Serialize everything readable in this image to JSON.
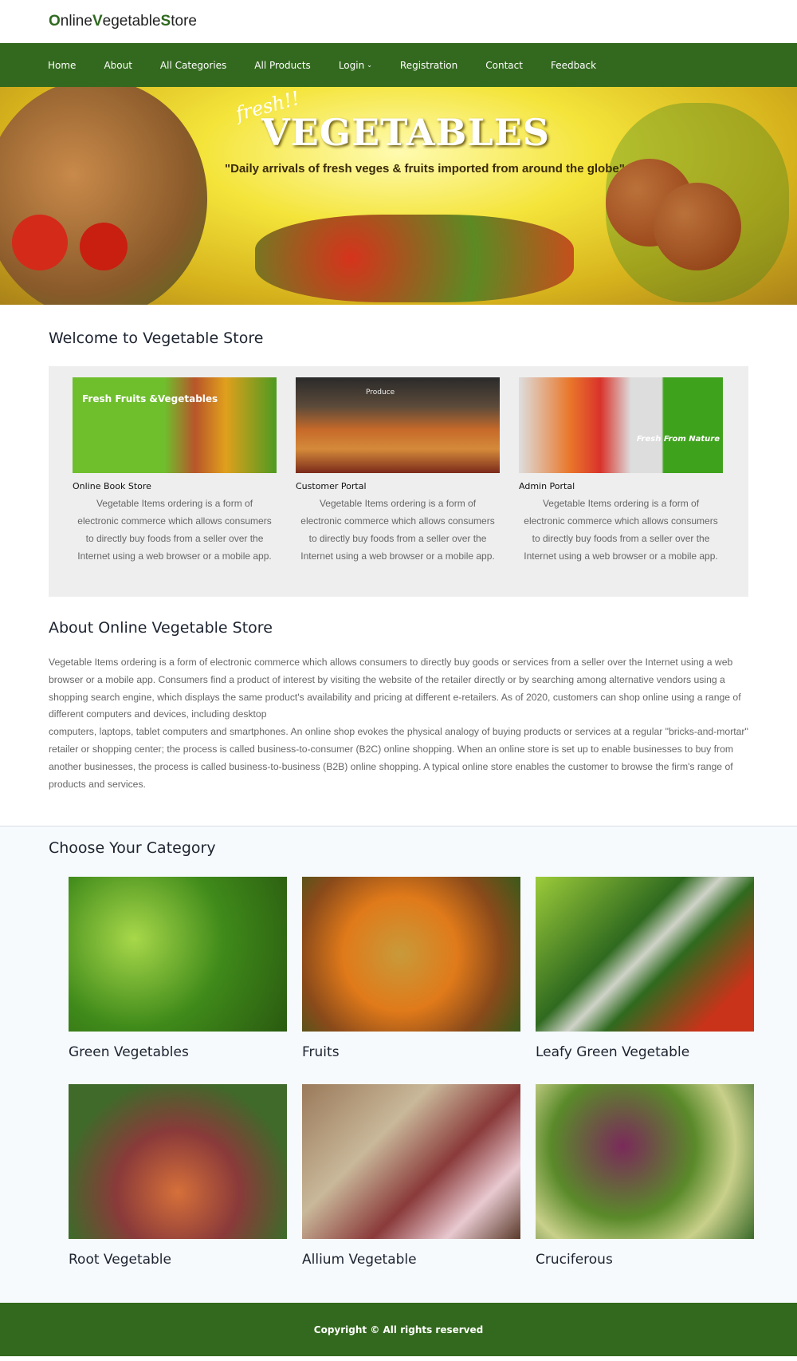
{
  "brand": {
    "first": "O",
    "w1": "nline ",
    "second": "V",
    "w2": "egetable ",
    "third": "S",
    "w3": "tore"
  },
  "nav": [
    "Home",
    "About",
    "All Categories",
    "All Products",
    "Login",
    "Registration",
    "Contact",
    "Feedback"
  ],
  "banner": {
    "script": "fresh!!",
    "title": "VEGETABLES",
    "tagline": "\"Daily arrivals of fresh veges & fruits imported from around the globe\""
  },
  "welcome": {
    "heading": "Welcome to Vegetable Store",
    "cards": [
      {
        "title": "Online Book Store",
        "image_text": "Fresh Fruits &Vegetables",
        "text": "Vegetable Items ordering is a form of electronic commerce which allows consumers to directly buy foods from a seller over the Internet using a web browser or a mobile app."
      },
      {
        "title": "Customer Portal",
        "image_text": "Produce",
        "text": "Vegetable Items ordering is a form of electronic commerce which allows consumers to directly buy foods from a seller over the Internet using a web browser or a mobile app."
      },
      {
        "title": "Admin Portal",
        "image_text": "Fresh From Nature",
        "text": "Vegetable Items ordering is a form of electronic commerce which allows consumers to directly buy foods from a seller over the Internet using a web browser or a mobile app."
      }
    ]
  },
  "about": {
    "heading": "About Online Vegetable Store",
    "p1": "Vegetable Items ordering is a form of electronic commerce which allows consumers to directly buy goods or services from a seller over the Internet using a web browser or a mobile app. Consumers find a product of interest by visiting the website of the retailer directly or by searching among alternative vendors using a shopping search engine, which displays the same product's availability and pricing at different e-retailers. As of 2020, customers can shop online using a range of different computers and devices, including desktop",
    "p2": "computers, laptops, tablet computers and smartphones. An online shop evokes the physical analogy of buying products or services at a regular \"bricks-and-mortar\" retailer or shopping center; the process is called business-to-consumer (B2C) online shopping. When an online store is set up to enable businesses to buy from another businesses, the process is called business-to-business (B2B) online shopping. A typical online store enables the customer to browse the firm's range of products and services."
  },
  "categories": {
    "heading": "Choose Your Category",
    "items": [
      "Green Vegetables",
      "Fruits",
      "Leafy Green Vegetable",
      "Root Vegetable",
      "Allium Vegetable",
      "Cruciferous"
    ]
  },
  "footer": "Copyright © All rights reserved",
  "colors": {
    "brand_green": "#33691e"
  }
}
